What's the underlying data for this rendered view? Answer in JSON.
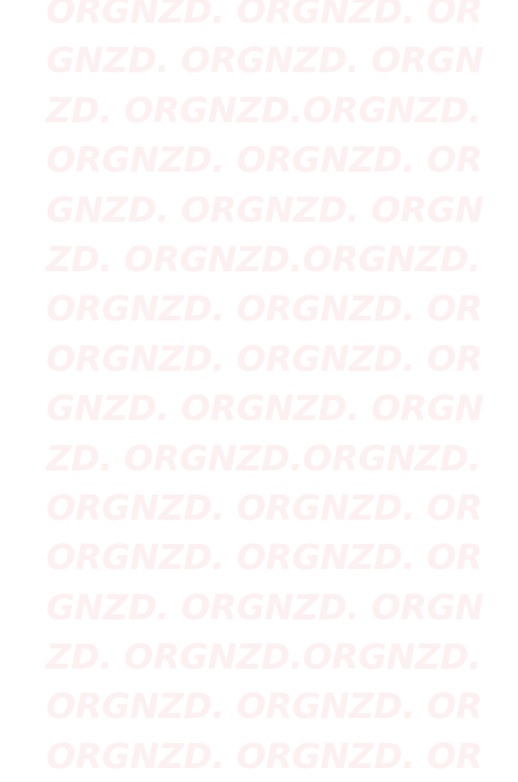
{
  "background": {
    "color": "#ffffff",
    "text_color": "#fdf0f1",
    "lines": [
      "ORGNZD. ORGNZD. OR",
      "GNZD. ORGNZD. ORGN",
      "ZD. ORGNZD.ORGNZD.",
      "ORGNZD. ORGNZD. OR",
      "GNZD. ORGNZD. ORGN",
      "ZD. ORGNZD.ORGNZD.",
      "ORGNZD. ORGNZD. OR",
      "ORGNZD. ORGNZD. OR",
      "GNZD. ORGNZD. ORGN",
      "ZD. ORGNZD.ORGNZD.",
      "ORGNZD. ORGNZD. OR",
      "ORGNZD. ORGNZD. OR",
      "GNZD. ORGNZD. ORGN",
      "ZD. ORGNZD.ORGNZD.",
      "ORGNZD. ORGNZD. OR",
      "ORGNZD. ORGNZD. OR"
    ]
  }
}
